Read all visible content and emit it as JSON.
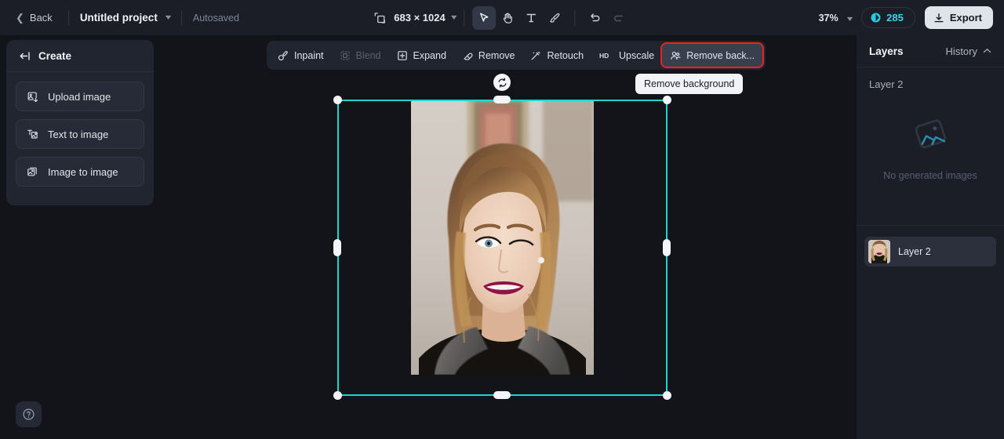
{
  "topbar": {
    "back_label": "Back",
    "project_name": "Untitled project",
    "autosave_label": "Autosaved",
    "canvas_size": "683 × 1024",
    "zoom_level": "37%",
    "credits": "285",
    "export_label": "Export",
    "tools": [
      {
        "name": "select-tool",
        "icon": "cursor-icon",
        "active": true
      },
      {
        "name": "hand-tool",
        "icon": "hand-icon",
        "active": false
      },
      {
        "name": "text-tool",
        "icon": "text-icon",
        "active": false
      },
      {
        "name": "brush-tool",
        "icon": "brush-icon",
        "active": false
      },
      {
        "name": "undo-tool",
        "icon": "undo-icon",
        "active": false
      },
      {
        "name": "redo-tool",
        "icon": "redo-icon",
        "active": false
      }
    ]
  },
  "sidebar": {
    "title": "Create",
    "collapse_icon": "collapse-left-icon",
    "items": [
      {
        "label": "Upload image",
        "icon": "upload-image-icon"
      },
      {
        "label": "Text to image",
        "icon": "text-to-image-icon"
      },
      {
        "label": "Image to image",
        "icon": "image-to-image-icon"
      }
    ],
    "help_icon": "help-question-icon"
  },
  "toolbar": {
    "items": [
      {
        "label": "Inpaint",
        "icon": "inpaint-brush-icon",
        "disabled": false,
        "highlighted": false
      },
      {
        "label": "Blend",
        "icon": "blend-icon",
        "disabled": true,
        "highlighted": false
      },
      {
        "label": "Expand",
        "icon": "expand-icon",
        "disabled": false,
        "highlighted": false
      },
      {
        "label": "Remove",
        "icon": "eraser-icon",
        "disabled": false,
        "highlighted": false
      },
      {
        "label": "Retouch",
        "icon": "retouch-wand-icon",
        "disabled": false,
        "highlighted": false
      },
      {
        "label": "Upscale",
        "icon": "hd-icon",
        "disabled": false,
        "highlighted": false
      },
      {
        "label": "Remove back...",
        "icon": "remove-background-icon",
        "disabled": false,
        "highlighted": true
      }
    ],
    "tooltip": "Remove background"
  },
  "right_panel": {
    "tab_layers": "Layers",
    "tab_history": "History",
    "history_caret_icon": "chevron-up-icon",
    "section_label": "Layer 2",
    "empty_state_text": "No generated images",
    "empty_state_icon": "image-placeholder-icon",
    "layers": [
      {
        "name": "Layer 2",
        "thumbnail": "portrait-thumbnail"
      }
    ]
  },
  "canvas": {
    "selection": {
      "accent_color": "#1fd5d0",
      "handle_color": "#f3f5f8",
      "rotate_icon": "rotate-icon"
    },
    "image_alt": "portrait-photo-woman-winking"
  },
  "colors": {
    "background": "#121419",
    "panel": "#1b1e27",
    "sidebar": "#212530",
    "accent_cyan": "#3ad6e8",
    "selection": "#1fd5d0",
    "highlight_red": "#f02020",
    "text_primary": "#f0f2f6",
    "text_muted": "#7e8697"
  }
}
